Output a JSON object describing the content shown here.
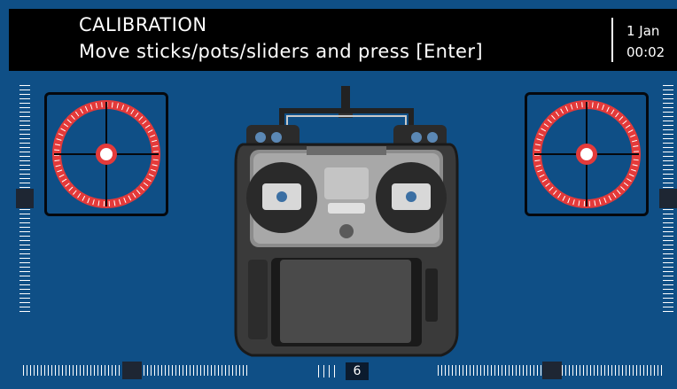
{
  "header": {
    "title": "CALIBRATION",
    "subtitle": "Move sticks/pots/sliders and press [Enter]",
    "date": "1 Jan",
    "time": "00:02"
  },
  "trim_indicator": {
    "value": "6"
  },
  "colors": {
    "background": "#0f4f86",
    "header": "#000000",
    "stick_ring": "#e43a3a",
    "slider_ticks": "#ffffff",
    "slider_thumb": "#1e2633"
  },
  "icons": {
    "left_stick": "stick-position-icon",
    "right_stick": "stick-position-icon",
    "radio": "radio-transmitter-icon"
  }
}
